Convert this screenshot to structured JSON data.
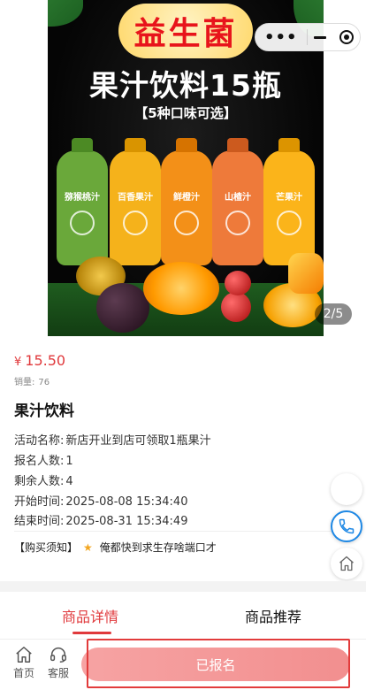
{
  "hero": {
    "banner_text": "益生菌",
    "title_text": "果汁饮料15瓶",
    "subtitle_text": "【5种口味可选】",
    "bottles": [
      {
        "label": "猕猴桃汁",
        "color": "#6aa83a"
      },
      {
        "label": "百香果汁",
        "color": "#f5b21b"
      },
      {
        "label": "鲜橙汁",
        "color": "#f39018"
      },
      {
        "label": "山楂汁",
        "color": "#ee7a3a"
      },
      {
        "label": "芒果汁",
        "color": "#fbb41a"
      }
    ],
    "counter": "2/5"
  },
  "capsule": {
    "more_icon": "more-dots-icon",
    "minimize_icon": "minimize-icon",
    "close_icon": "target-close-icon"
  },
  "product": {
    "currency": "¥",
    "price": "15.50",
    "sold_label": "销量:",
    "sold_count": "76",
    "name": "果汁饮料"
  },
  "details": {
    "activity_label": "活动名称:",
    "activity_value": "新店开业到店可领取1瓶果汁",
    "registered_label": "报名人数:",
    "registered_value": "1",
    "remaining_label": "剩余人数:",
    "remaining_value": "4",
    "start_label": "开始时间:",
    "start_value": "2025-08-08 15:34:40",
    "end_label": "结束时间:",
    "end_value": "2025-08-31 15:34:49"
  },
  "notice": {
    "label": "【购买须知】",
    "text": "俺都快到求生存啥端口才"
  },
  "tabs": {
    "detail": "商品详情",
    "recommend": "商品推荐"
  },
  "bottom": {
    "home_label": "首页",
    "service_label": "客服",
    "action_label": "已报名"
  },
  "colors": {
    "accent": "#e0393c",
    "button": "#f4a0a0",
    "star": "#f3a621"
  }
}
